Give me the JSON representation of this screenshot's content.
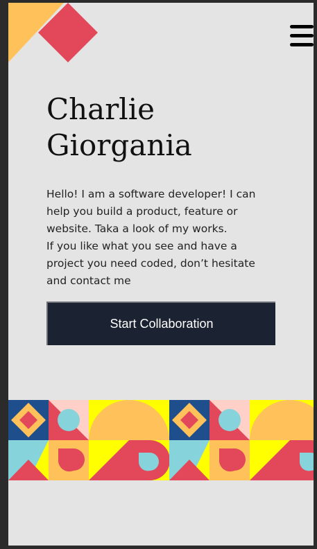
{
  "colors": {
    "background": "#e4e4e4",
    "button": "#1b2232",
    "yellow": "#ffff00",
    "orange": "#ffc25a",
    "red": "#e2475a",
    "navy": "#1e4e8c",
    "cyan": "#86d3dc",
    "pink": "#ffd0c7"
  },
  "nav": {
    "menu_icon": "hamburger-icon"
  },
  "hero": {
    "name_line1": "Charlie",
    "name_line2": "Giorgania",
    "bio_line1": "Hello! I am a software developer! I can help you build a product, feature or website. Taka a look of my works.",
    "bio_line2": "If you like what you see and have a project you need coded, don’t hesitate and contact me",
    "cta_label": "Start Collaboration"
  }
}
